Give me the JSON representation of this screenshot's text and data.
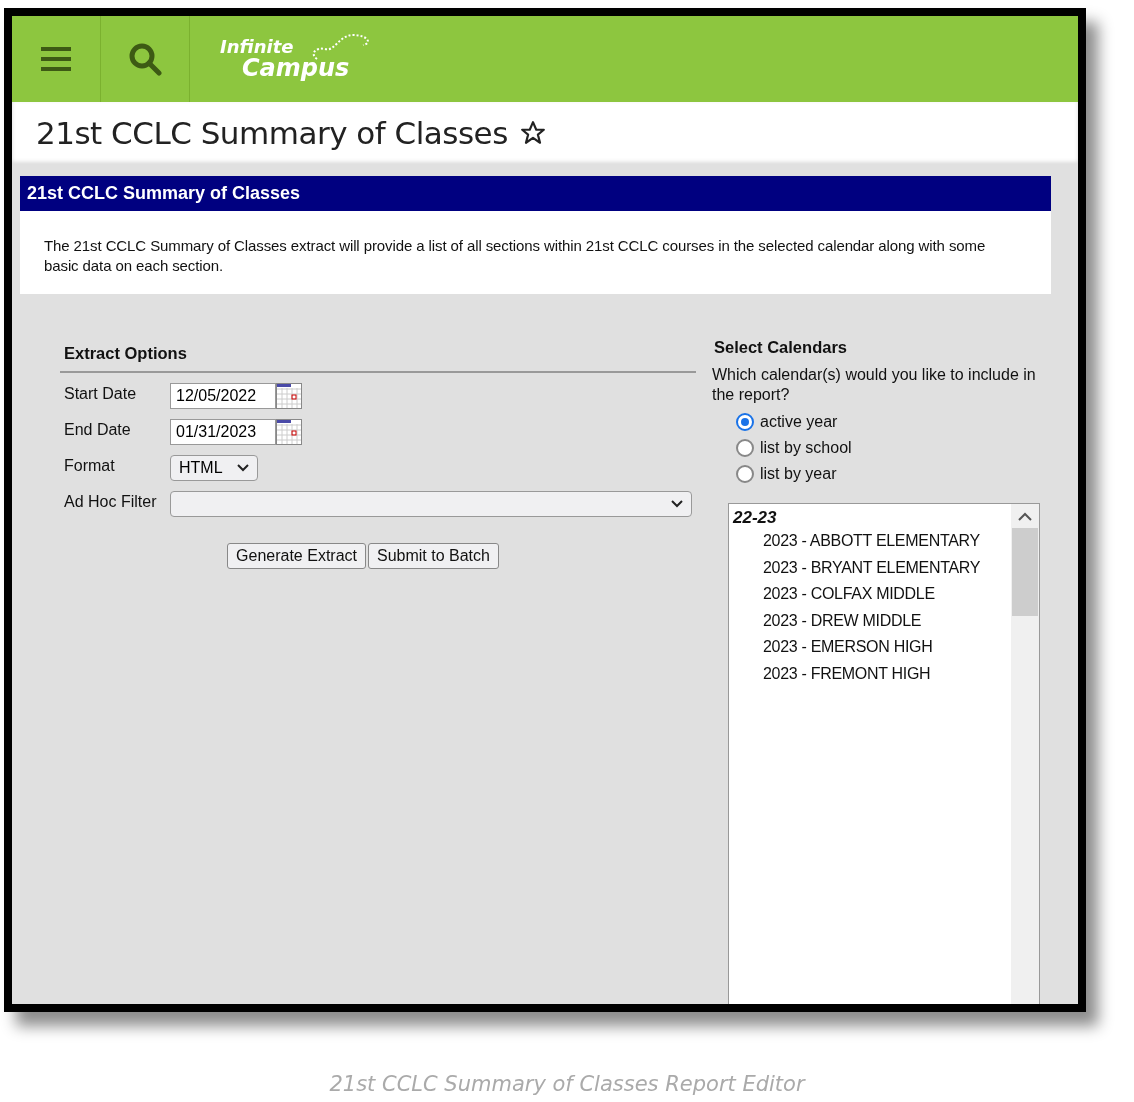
{
  "header": {
    "logo": {
      "line_1": "Infinite",
      "line_2": "Campus"
    }
  },
  "page_title": {
    "text": "21st CCLC Summary of Classes",
    "favorite": false
  },
  "panel": {
    "title": "21st CCLC Summary of Classes",
    "description": "The 21st CCLC Summary of Classes extract will provide a list of all sections within 21st CCLC courses in the selected calendar along with some basic data on each section."
  },
  "extract_options": {
    "heading": "Extract Options",
    "fields": [
      {
        "label": "Start Date",
        "kind": "date",
        "value": "12/05/2022"
      },
      {
        "label": "End Date",
        "kind": "date",
        "value": "01/31/2023"
      },
      {
        "label": "Format",
        "kind": "select",
        "value": "HTML"
      },
      {
        "label": "Ad Hoc Filter",
        "kind": "wide-select"
      }
    ],
    "buttons": [
      "Generate Extract",
      "Submit to Batch"
    ]
  },
  "select_calendars": {
    "heading": "Select Calendars",
    "question": "Which calendar(s) would you like to include in the report?",
    "options": [
      {
        "label": "active year",
        "selected": true
      },
      {
        "label": "list by school",
        "selected": false
      },
      {
        "label": "list by year",
        "selected": false
      }
    ],
    "list": {
      "group": "22-23",
      "items": [
        "2023 - ABBOTT ELEMENTARY",
        "2023 - BRYANT ELEMENTARY",
        "2023 - COLFAX MIDDLE",
        "2023 - DREW MIDDLE",
        "2023 - EMERSON HIGH",
        "2023 - FREMONT HIGH"
      ]
    }
  },
  "caption": "21st CCLC Summary of Classes Report Editor"
}
